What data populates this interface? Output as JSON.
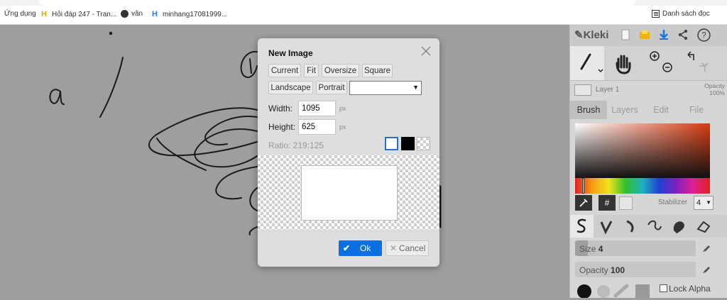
{
  "bookmarks": [
    {
      "label": "Ứng dụng",
      "icon": "apps-grid-icon"
    },
    {
      "label": "Hỏi đáp 247 - Tran...",
      "icon": "h-logo-icon"
    },
    {
      "label": "vân",
      "icon": "globe-icon"
    },
    {
      "label": "minhang17081999...",
      "icon": "h-logo-icon"
    }
  ],
  "reading_list": {
    "label": "Danh sách đọc",
    "icon": "reading-list-icon"
  },
  "dialog": {
    "title": "New Image",
    "presets_row1": [
      "Current",
      "Fit",
      "Oversize",
      "Square"
    ],
    "presets_row2": [
      "Landscape",
      "Portrait"
    ],
    "select_value": "",
    "width_label": "Width:",
    "width_value": "1095",
    "height_label": "Height:",
    "height_value": "625",
    "unit": "px",
    "ratio": "Ratio: 219:125",
    "background_options": [
      "white",
      "black",
      "transparent"
    ],
    "ok_label": "Ok",
    "cancel_label": "Cancel",
    "accent_color": "#0a6fe0"
  },
  "panel": {
    "app_name": "Kleki",
    "layer": {
      "name": "Layer 1",
      "opacity_label": "Opacity",
      "opacity_value": "100%"
    },
    "tabs": [
      "Brush",
      "Layers",
      "Edit",
      "File"
    ],
    "active_tab": "Brush",
    "hex_button": "#",
    "stabilizer_label": "Stabilizer",
    "stabilizer_value": "4",
    "size_label": "Size",
    "size_value": "4",
    "opacity_label": "Opacity",
    "opacity_value": "100",
    "lock_alpha": "Lock Alpha"
  }
}
